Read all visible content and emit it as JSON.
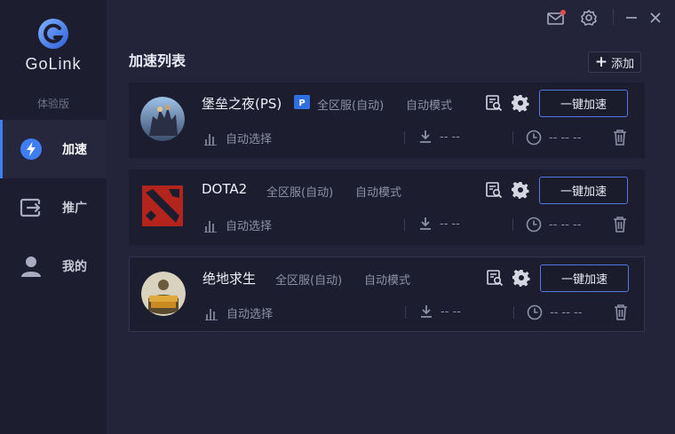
{
  "app": {
    "brand": "GoLink",
    "edition": "体验版",
    "accent_color": "#3f7df2"
  },
  "sidebar": {
    "items": [
      {
        "label": "加速",
        "icon": "lightning-icon",
        "active": true
      },
      {
        "label": "推广",
        "icon": "share-icon",
        "active": false
      },
      {
        "label": "我的",
        "icon": "user-icon",
        "active": false
      }
    ]
  },
  "titlebar": {
    "icons": [
      "mail-icon",
      "settings-icon",
      "minimize-icon",
      "close-icon"
    ],
    "mail_has_notification": true
  },
  "main": {
    "title": "加速列表",
    "add_label": "添加"
  },
  "games": [
    {
      "name": "堡垒之夜(PS)",
      "platform_badge": "playstation-icon",
      "region": "全区服(自动)",
      "mode": "自动模式",
      "boost_label": "一键加速",
      "route": "自动选择",
      "download": "-- --",
      "time": "-- -- --"
    },
    {
      "name": "DOTA2",
      "platform_badge": null,
      "region": "全区服(自动)",
      "mode": "自动模式",
      "boost_label": "一键加速",
      "route": "自动选择",
      "download": "-- --",
      "time": "-- -- --"
    },
    {
      "name": "绝地求生",
      "platform_badge": null,
      "region": "全区服(自动)",
      "mode": "自动模式",
      "boost_label": "一键加速",
      "route": "自动选择",
      "download": "-- --",
      "time": "-- -- --"
    }
  ]
}
